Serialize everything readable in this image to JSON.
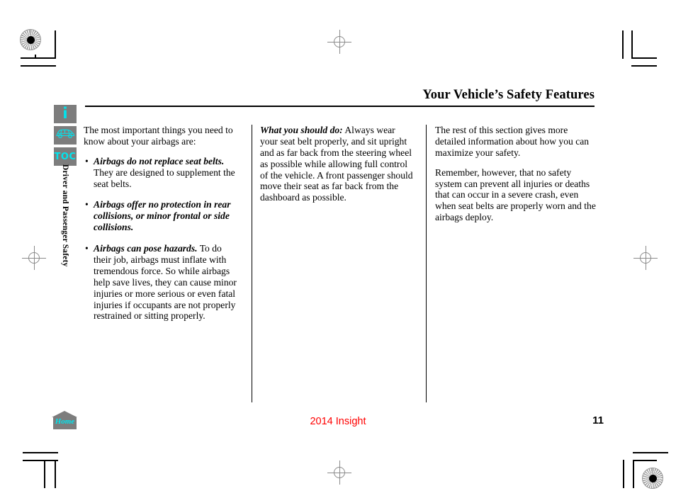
{
  "header": {
    "title": "Your Vehicle’s Safety Features"
  },
  "rail": {
    "info_icon_label": "i",
    "vehicle_icon_name": "car-outline-icon",
    "toc_icon_label": "TOC",
    "section_label": "Driver and Passenger Safety"
  },
  "columns": {
    "col1": {
      "intro": "The most important things you need to know about your airbags are:",
      "bullets": [
        {
          "lead": "Airbags do not replace seat belts.",
          "rest": " They are designed to supplement the seat belts."
        },
        {
          "lead": "Airbags offer no protection in rear collisions, or minor frontal or side collisions.",
          "rest": ""
        },
        {
          "lead": "Airbags can pose hazards.",
          "rest": " To do their job, airbags must inflate with tremendous force. So while airbags help save lives, they can cause minor injuries or more serious or even fatal injuries if occupants are not properly restrained or sitting properly."
        }
      ]
    },
    "col2": {
      "lead": "What you should do:",
      "rest": " Always wear your seat belt properly, and sit upright and as far back from the steering wheel as possible while allowing full control of the vehicle. A front passenger should move their seat as far back from the dashboard as possible."
    },
    "col3": {
      "para1": "The rest of this section gives more detailed information about how you can maximize your safety.",
      "para2": "Remember, however, that no safety system can prevent all injuries or deaths that can occur in a severe crash, even when seat belts are properly worn and the airbags deploy."
    }
  },
  "footer": {
    "home_label": "Home",
    "model": "2014 Insight",
    "page_number": "11"
  },
  "colors": {
    "accent_cyan": "#00e5ee",
    "icon_gray": "#7d7d7d",
    "model_red": "#ff0000"
  }
}
